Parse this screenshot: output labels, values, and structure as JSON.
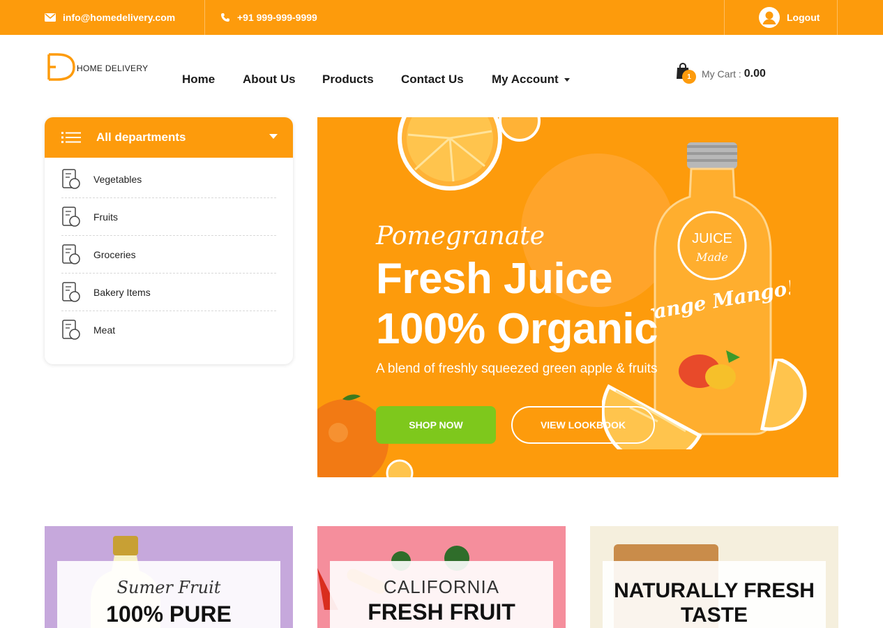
{
  "topbar": {
    "email": "info@homedelivery.com",
    "phone": "+91 999-999-9999",
    "logout": "Logout"
  },
  "logo": {
    "text": "HOME DELIVERY"
  },
  "nav": {
    "items": [
      {
        "label": "Home"
      },
      {
        "label": "About Us"
      },
      {
        "label": "Products"
      },
      {
        "label": "Contact Us"
      },
      {
        "label": "My Account"
      }
    ]
  },
  "cart": {
    "count": "1",
    "label": "My Cart :",
    "value": "0.00"
  },
  "departments": {
    "title": "All departments",
    "items": [
      {
        "label": "Vegetables"
      },
      {
        "label": "Fruits"
      },
      {
        "label": "Groceries"
      },
      {
        "label": "Bakery Items"
      },
      {
        "label": "Meat"
      }
    ]
  },
  "hero": {
    "subtitle": "Pomegranate",
    "title_line1": "Fresh Juice",
    "title_line2": "100% Organic",
    "description": "A blend of freshly squeezed green apple & fruits",
    "shop_button": "SHOP NOW",
    "lookbook_button": "VIEW LOOKBOOK",
    "bottle_badge_top": "JUICE",
    "bottle_badge_bottom": "Made",
    "bottle_label": "Orange Mango!"
  },
  "cards": [
    {
      "subtitle": "Sumer Fruit",
      "title": "100% PURE"
    },
    {
      "subtitle": "CALIFORNIA",
      "title": "FRESH FRUIT"
    },
    {
      "title_line1": "NATURALLY FRESH",
      "title_line2": "TASTE"
    }
  ],
  "colors": {
    "primary": "#fd9b0c",
    "green": "#7ec81c",
    "card1": "#c6a8dc",
    "card2": "#f58e9c",
    "card3": "#f5efdd"
  }
}
